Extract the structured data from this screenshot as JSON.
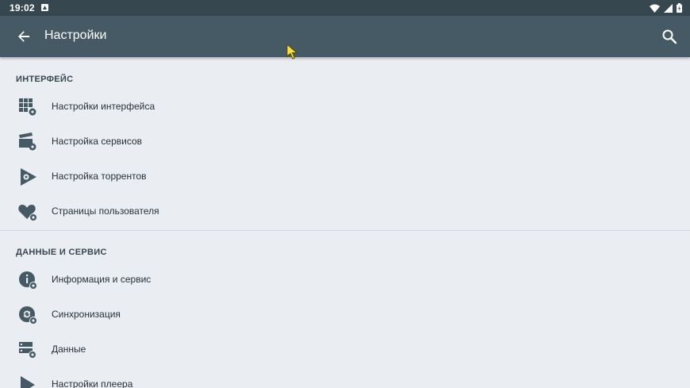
{
  "status_bar": {
    "time": "19:02",
    "icons": [
      "notification-icon",
      "wifi-icon",
      "signal-icon",
      "battery-icon"
    ]
  },
  "app_bar": {
    "title": "Настройки",
    "back_icon": "arrow-back-icon",
    "search_icon": "search-icon"
  },
  "sections": [
    {
      "header": "ИНТЕРФЕЙС",
      "items": [
        {
          "label": "Настройки интерфейса",
          "icon": "grid-settings-icon"
        },
        {
          "label": "Настройка сервисов",
          "icon": "clapper-settings-icon"
        },
        {
          "label": "Настройка торрентов",
          "icon": "torrent-icon"
        },
        {
          "label": "Страницы пользователя",
          "icon": "heart-settings-icon"
        }
      ]
    },
    {
      "header": "ДАННЫЕ И СЕРВИС",
      "items": [
        {
          "label": "Информация и сервис",
          "icon": "info-settings-icon"
        },
        {
          "label": "Синхронизация",
          "icon": "sync-settings-icon"
        },
        {
          "label": "Данные",
          "icon": "storage-settings-icon"
        },
        {
          "label": "Настройки плеера",
          "icon": "play-icon"
        }
      ]
    }
  ],
  "colors": {
    "status_bar": "#37474f",
    "app_bar": "#455a64",
    "background": "#eaedf1",
    "icon": "#455a64",
    "text": "#263238"
  }
}
